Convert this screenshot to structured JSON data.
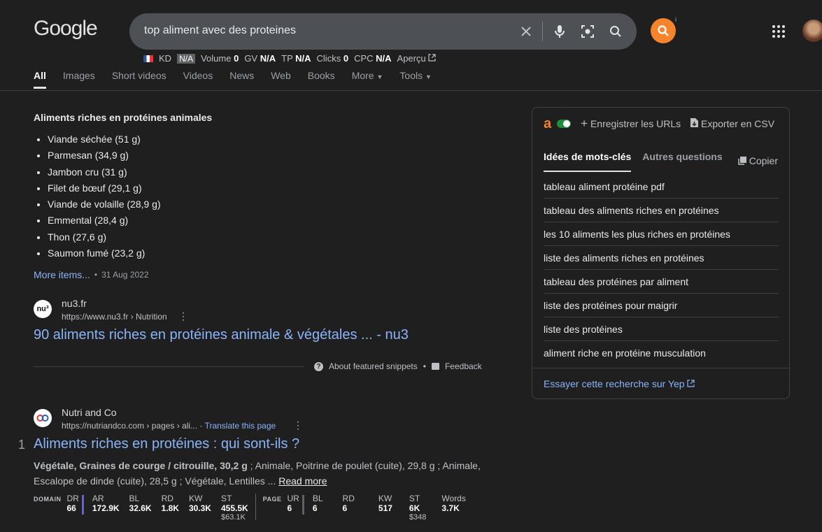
{
  "header": {
    "logo": "Google",
    "query": "top aliment avec des proteines",
    "ext_info": "i"
  },
  "metrics": {
    "kd_label": "KD",
    "kd_value": "N/A",
    "volume_label": "Volume",
    "volume_value": "0",
    "gv_label": "GV",
    "gv_value": "N/A",
    "tp_label": "TP",
    "tp_value": "N/A",
    "clicks_label": "Clicks",
    "clicks_value": "0",
    "cpc_label": "CPC",
    "cpc_value": "N/A",
    "preview_label": "Aperçu"
  },
  "tabs": [
    "All",
    "Images",
    "Short videos",
    "Videos",
    "News",
    "Web",
    "Books",
    "More",
    "Tools"
  ],
  "snippet": {
    "title": "Aliments riches en protéines animales",
    "items": [
      "Viande séchée (51 g)",
      "Parmesan (34,9 g)",
      "Jambon cru (31 g)",
      "Filet de bœuf (29,1 g)",
      "Viande de volaille (28,9 g)",
      "Emmental (28,4 g)",
      "Thon (27,6 g)",
      "Saumon fumé (23,2 g)"
    ],
    "more_items": "More items...",
    "date": "31 Aug 2022",
    "site_name": "nu3.fr",
    "site_url": "https://www.nu3.fr › Nutrition",
    "result_title": "90 aliments riches en protéines animale & végétales ... - nu3",
    "about": "About featured snippets",
    "feedback": "Feedback"
  },
  "result1": {
    "rank": "1",
    "site_name": "Nutri and Co",
    "site_url": "https://nutriandco.com › pages › ali...",
    "translate": "Translate this page",
    "title": "Aliments riches en protéines : qui sont-ils ?",
    "desc_bold": "Végétale, Graines de courge / citrouille, 30,2 g",
    "desc_rest": " ; Animale, Poitrine de poulet (cuite), 29,8 g ; Animale, Escalope de dinde (cuite), 28,5 g ; Végétale, Lentilles ... ",
    "read_more": "Read more",
    "seo": {
      "domain_label": "DOMAIN",
      "page_label": "PAGE",
      "domain": [
        {
          "k": "DR",
          "v": "66"
        },
        {
          "k": "AR",
          "v": "172.9K"
        },
        {
          "k": "BL",
          "v": "32.6K"
        },
        {
          "k": "RD",
          "v": "1.8K"
        },
        {
          "k": "KW",
          "v": "30.3K"
        },
        {
          "k": "ST",
          "v": "455.5K",
          "s": "$63.1K"
        }
      ],
      "page": [
        {
          "k": "UR",
          "v": "6"
        },
        {
          "k": "BL",
          "v": "6"
        },
        {
          "k": "RD",
          "v": "6"
        },
        {
          "k": "KW",
          "v": "517"
        },
        {
          "k": "ST",
          "v": "6K",
          "s": "$348"
        },
        {
          "k": "Words",
          "v": "3.7K"
        }
      ]
    }
  },
  "panel": {
    "logo": "a",
    "save_urls": "Enregistrer les URLs",
    "export_csv": "Exporter en CSV",
    "tab_keywords": "Idées de mots-clés",
    "tab_questions": "Autres questions",
    "copy": "Copier",
    "keywords": [
      "tableau aliment protéine pdf",
      "tableau des aliments riches en protéines",
      "les 10 aliments les plus riches en protéines",
      "liste des aliments riches en protéines",
      "tableau des protéines par aliment",
      "liste des protéines pour maigrir",
      "liste des protéines",
      "aliment riche en protéine musculation"
    ],
    "yep": "Essayer cette recherche sur Yep"
  },
  "colors": {
    "accent": "#8ab4f8",
    "ahrefs": "#f7832b",
    "bg": "#1f1f1f"
  }
}
